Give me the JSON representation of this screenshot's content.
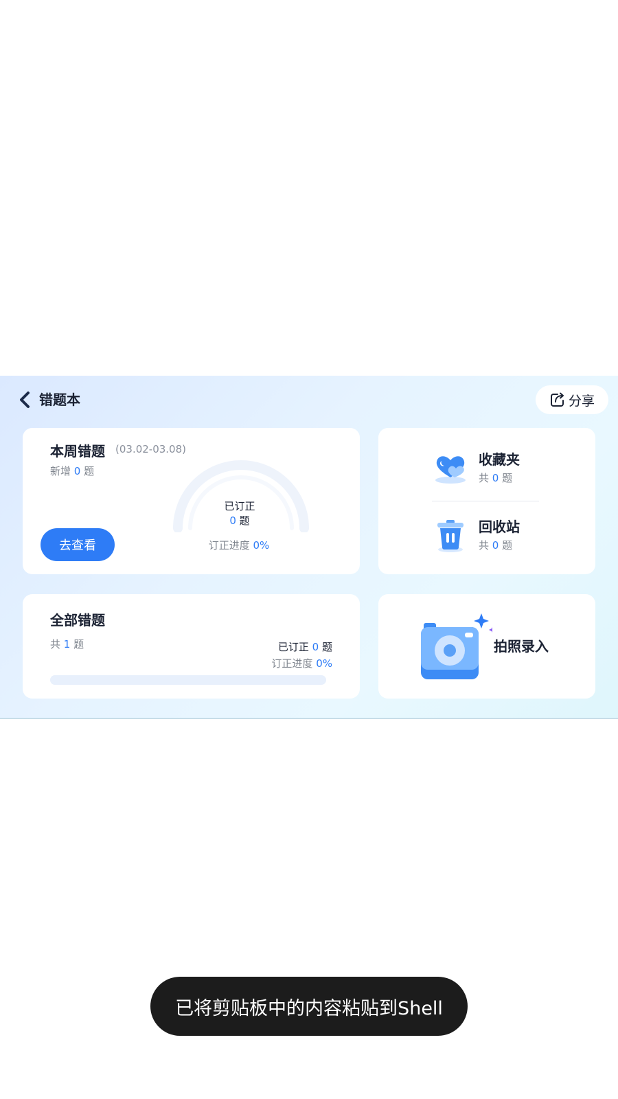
{
  "header": {
    "title": "错题本",
    "share_label": "分享",
    "back_icon": "chevron-left-icon",
    "share_icon": "share-icon"
  },
  "weekly": {
    "title": "本周错题",
    "date_range": "(03.02-03.08)",
    "new_prefix": "新增",
    "new_count": "0",
    "unit": "题",
    "corrected_label": "已订正",
    "corrected_count": "0",
    "progress_label": "订正进度",
    "progress_value": "0%",
    "progress_fraction": 0,
    "view_button": "去查看"
  },
  "favorites": {
    "title": "收藏夹",
    "prefix": "共",
    "count": "0",
    "unit": "题",
    "icon": "heart-folder-icon"
  },
  "recycle": {
    "title": "回收站",
    "prefix": "共",
    "count": "0",
    "unit": "题",
    "icon": "trash-icon"
  },
  "all": {
    "title": "全部错题",
    "prefix": "共",
    "count": "1",
    "unit": "题",
    "corrected_label": "已订正",
    "corrected_count": "0",
    "progress_label": "订正进度",
    "progress_value": "0%",
    "progress_fraction": 0
  },
  "photo": {
    "label": "拍照录入",
    "icon": "camera-icon"
  },
  "toast": {
    "text": "已将剪贴板中的内容粘贴到Shell"
  },
  "colors": {
    "accent": "#2e7cf6",
    "text": "#1b2233",
    "muted": "#80868f"
  }
}
